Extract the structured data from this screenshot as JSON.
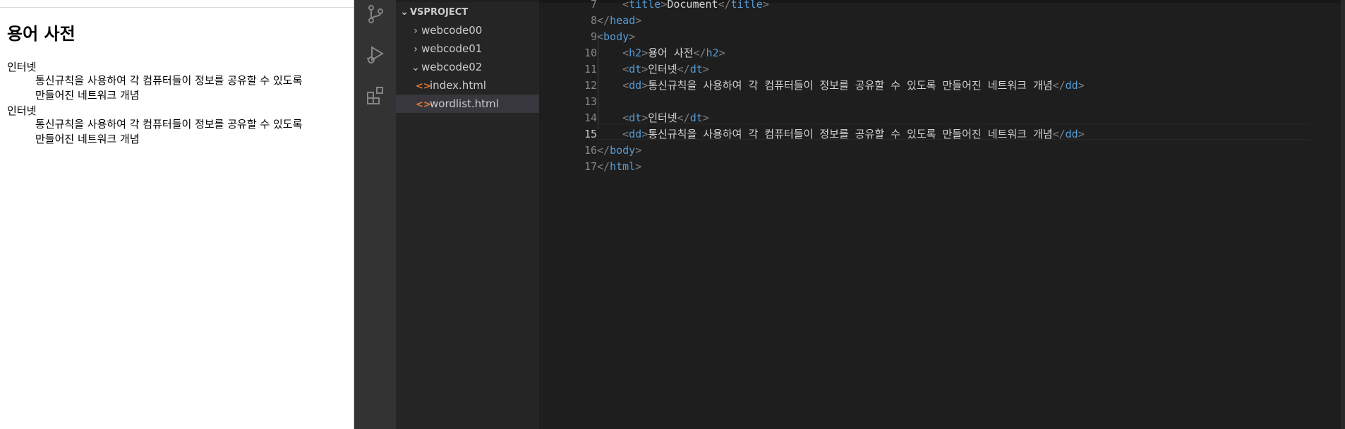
{
  "preview": {
    "title": "용어 사전",
    "entries": [
      {
        "term": "인터넷",
        "def_line1": "통신규칙을 사용하여 각 컴퓨터들이 정보를 공유할 수 있도록",
        "def_line2": "만들어진 네트워크 개념"
      },
      {
        "term": "인터넷",
        "def_line1": "통신규칙을 사용하여 각 컴퓨터들이 정보를 공유할 수 있도록",
        "def_line2": "만들어진 네트워크 개념"
      }
    ]
  },
  "activitybar": {
    "icons": [
      "source-control-icon",
      "run-debug-icon",
      "extensions-icon"
    ]
  },
  "explorer": {
    "root": "VSPROJECT",
    "folders": [
      "webcode00",
      "webcode01",
      "webcode02"
    ],
    "files": [
      "index.html",
      "wordlist.html"
    ],
    "selected_file": "wordlist.html"
  },
  "editor": {
    "active_line": 15,
    "lines": [
      {
        "n": "7",
        "parts": [
          [
            "br",
            "    <"
          ],
          [
            "tag",
            "title"
          ],
          [
            "br",
            ">"
          ],
          [
            "txt",
            "Document"
          ],
          [
            "br",
            "</"
          ],
          [
            "tag",
            "title"
          ],
          [
            "br",
            ">"
          ]
        ]
      },
      {
        "n": "8",
        "parts": [
          [
            "br",
            "</"
          ],
          [
            "tag",
            "head"
          ],
          [
            "br",
            ">"
          ]
        ]
      },
      {
        "n": "9",
        "parts": [
          [
            "br",
            "<"
          ],
          [
            "tag",
            "body"
          ],
          [
            "br",
            ">"
          ]
        ]
      },
      {
        "n": "10",
        "parts": [
          [
            "br",
            "    <"
          ],
          [
            "tag",
            "h2"
          ],
          [
            "br",
            ">"
          ],
          [
            "txt",
            "용어 사전"
          ],
          [
            "br",
            "</"
          ],
          [
            "tag",
            "h2"
          ],
          [
            "br",
            ">"
          ]
        ]
      },
      {
        "n": "11",
        "parts": [
          [
            "br",
            "    <"
          ],
          [
            "tag",
            "dt"
          ],
          [
            "br",
            ">"
          ],
          [
            "txt",
            "인터넷"
          ],
          [
            "br",
            "</"
          ],
          [
            "tag",
            "dt"
          ],
          [
            "br",
            ">"
          ]
        ]
      },
      {
        "n": "12",
        "parts": [
          [
            "br",
            "    <"
          ],
          [
            "tag",
            "dd"
          ],
          [
            "br",
            ">"
          ],
          [
            "txt",
            "통신규칙을 사용하여 각 컴퓨터들이 정보를 공유할 수 있도록 만들어진 네트워크 개념"
          ],
          [
            "br",
            "</"
          ],
          [
            "tag",
            "dd"
          ],
          [
            "br",
            ">"
          ]
        ]
      },
      {
        "n": "13",
        "parts": []
      },
      {
        "n": "14",
        "parts": [
          [
            "br",
            "    <"
          ],
          [
            "tag",
            "dt"
          ],
          [
            "br",
            ">"
          ],
          [
            "txt",
            "인터넷"
          ],
          [
            "br",
            "</"
          ],
          [
            "tag",
            "dt"
          ],
          [
            "br",
            ">"
          ]
        ]
      },
      {
        "n": "15",
        "parts": [
          [
            "br",
            "    <"
          ],
          [
            "tag",
            "dd"
          ],
          [
            "br",
            ">"
          ],
          [
            "txt",
            "통신규칙을 사용하여 각 컴퓨터들이 정보를 공유할 수 있도록 만들어진 네트워크 개념"
          ],
          [
            "br",
            "</"
          ],
          [
            "tag",
            "dd"
          ],
          [
            "br",
            ">"
          ]
        ]
      },
      {
        "n": "16",
        "parts": [
          [
            "br",
            "</"
          ],
          [
            "tag",
            "body"
          ],
          [
            "br",
            ">"
          ]
        ]
      },
      {
        "n": "17",
        "parts": [
          [
            "br",
            "</"
          ],
          [
            "tag",
            "html"
          ],
          [
            "br",
            ">"
          ]
        ]
      }
    ]
  },
  "colors": {
    "tag": "#569cd6",
    "bracket": "#808080",
    "text": "#d4d4d4",
    "editor_bg": "#1e1e1e",
    "sidebar_bg": "#252526",
    "activitybar_bg": "#333333",
    "html_icon": "#e37933"
  }
}
